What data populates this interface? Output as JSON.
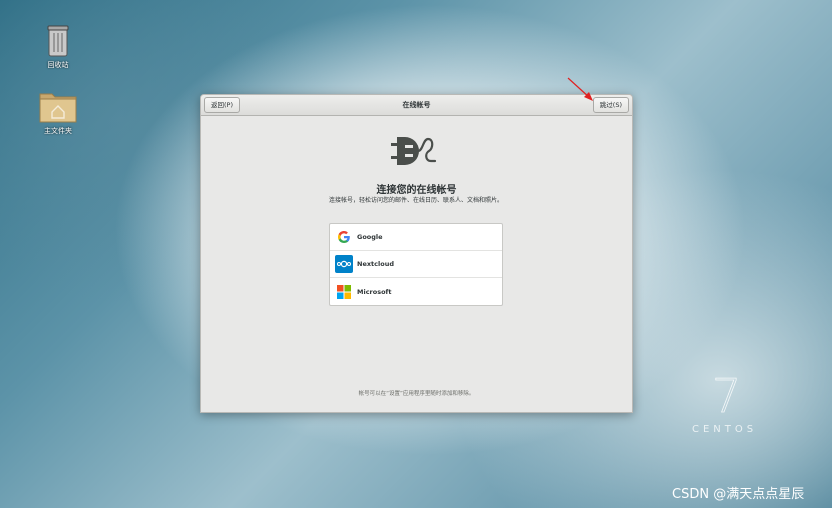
{
  "desktop": {
    "icons": [
      {
        "label": "回收站",
        "icon": "trash-icon"
      },
      {
        "label": "主文件夹",
        "icon": "home-folder-icon"
      }
    ],
    "branding": "CENTOS",
    "version": "7",
    "watermark": "CSDN @满天点点星辰"
  },
  "window": {
    "title": "在线帐号",
    "back_label": "返回(P)",
    "skip_label": "跳过(S)",
    "heading": "连接您的在线帐号",
    "description": "连接帐号，轻松访问您的邮件、在线日历、联系人、文档和照片。",
    "providers": [
      {
        "name": "Google",
        "icon": "google-icon"
      },
      {
        "name": "Nextcloud",
        "icon": "nextcloud-icon"
      },
      {
        "name": "Microsoft",
        "icon": "microsoft-icon"
      }
    ],
    "footer": "帐号可以在“设置”应用程序里随时添加和移除。"
  },
  "colors": {
    "annotation_arrow": "#e02020",
    "nextcloud": "#0082c9"
  }
}
